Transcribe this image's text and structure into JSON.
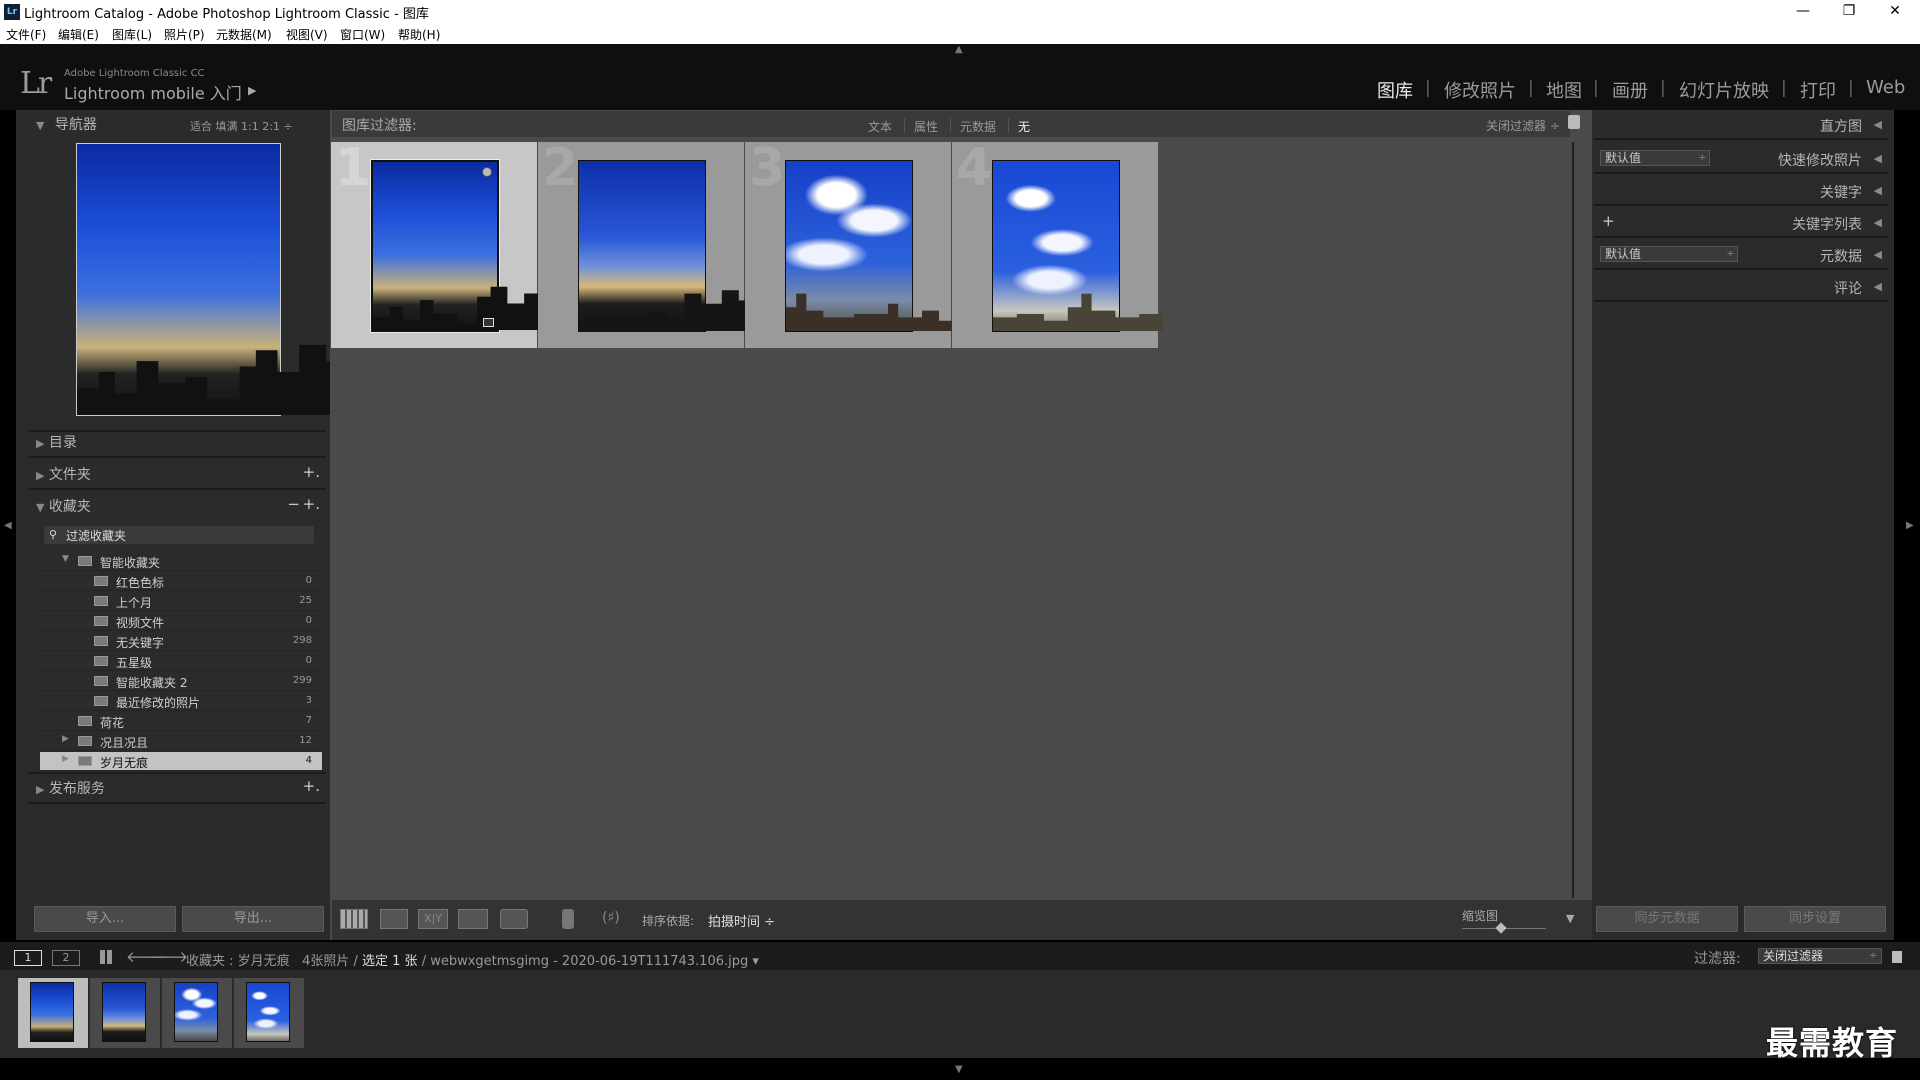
{
  "window": {
    "title": "Lightroom Catalog - Adobe Photoshop Lightroom Classic - 图库",
    "icon_text": "Lr",
    "minimize": "—",
    "restore": "❐",
    "close": "✕"
  },
  "menu": [
    "文件(F)",
    "编辑(E)",
    "图库(L)",
    "照片(P)",
    "元数据(M)",
    "视图(V)",
    "窗口(W)",
    "帮助(H)"
  ],
  "identity": {
    "logo": "Lr",
    "small_text": "Adobe Lightroom Classic CC",
    "big_text": "Lightroom mobile 入门",
    "arrow": "▶"
  },
  "modules": [
    "图库",
    "修改照片",
    "地图",
    "画册",
    "幻灯片放映",
    "打印",
    "Web"
  ],
  "modules_active": "图库",
  "navigator": {
    "title": "导航器",
    "options": "适合   填满   1:1   2:1  ÷"
  },
  "left_panels": {
    "catalog": "目录",
    "folders": "文件夹",
    "collections": "收藏夹",
    "publish": "发布服务",
    "plus": "+.",
    "minus": "−"
  },
  "collections": {
    "search_placeholder": "过滤收藏夹",
    "search_icon": "search-icon",
    "tree": [
      {
        "name": "智能收藏夹",
        "count": "",
        "level": 0,
        "expanded": true
      },
      {
        "name": "红色色标",
        "count": "0",
        "level": 1
      },
      {
        "name": "上个月",
        "count": "25",
        "level": 1
      },
      {
        "name": "视频文件",
        "count": "0",
        "level": 1
      },
      {
        "name": "无关键字",
        "count": "298",
        "level": 1
      },
      {
        "name": "五星级",
        "count": "0",
        "level": 1
      },
      {
        "name": "智能收藏夹 2",
        "count": "299",
        "level": 1
      },
      {
        "name": "最近修改的照片",
        "count": "3",
        "level": 1
      },
      {
        "name": "荷花",
        "count": "7",
        "level": 0
      },
      {
        "name": "况且况且",
        "count": "12",
        "level": 0
      },
      {
        "name": "岁月无痕",
        "count": "4",
        "level": 0,
        "selected": true
      }
    ]
  },
  "left_buttons": {
    "import": "导入...",
    "export": "导出..."
  },
  "filter_bar": {
    "label": "图库过滤器:",
    "options": [
      "文本",
      "属性",
      "元数据",
      "无"
    ],
    "active": "无",
    "preset": "关闭过滤器 ÷"
  },
  "grid": {
    "cells": [
      {
        "num": "1",
        "selected": true,
        "style": "sunset"
      },
      {
        "num": "2",
        "selected": false,
        "style": "sunset2"
      },
      {
        "num": "3",
        "selected": false,
        "style": "cloudy"
      },
      {
        "num": "4",
        "selected": false,
        "style": "cloudy2"
      }
    ]
  },
  "toolbar": {
    "sort_label": "排序依据:",
    "sort_value": "拍摄时间 ÷",
    "thumb_label": "缩览图",
    "xy_label": "X|Y",
    "sort_icon": "a-z-sort-icon"
  },
  "right_panels": {
    "histogram": "直方图",
    "quick_develop": "快速修改照片",
    "quick_develop_preset": "默认值",
    "keywording": "关键字",
    "keyword_list": "关键字列表",
    "metadata": "元数据",
    "metadata_preset": "默认值",
    "comments": "评论",
    "plus": "+"
  },
  "right_buttons": {
    "sync_metadata": "同步元数据",
    "sync_settings": "同步设置"
  },
  "filmstrip": {
    "page1": "1",
    "page2": "2",
    "source_prefix": "收藏夹 : 岁月无痕",
    "count": "4张照片 /",
    "selected": "选定 1 张",
    "filename": "/ webwxgetmsgimg - 2020-06-19T111743.106.jpg ▾",
    "filter_label": "过滤器:",
    "filter_value": "关闭过滤器"
  },
  "watermark": "最需教育",
  "colors": {
    "background": "#000000",
    "panel": "#2b2b2b",
    "center": "#4a4a4a",
    "selected_cell": "#c7c7c7",
    "active_module": "#eaeaea"
  }
}
